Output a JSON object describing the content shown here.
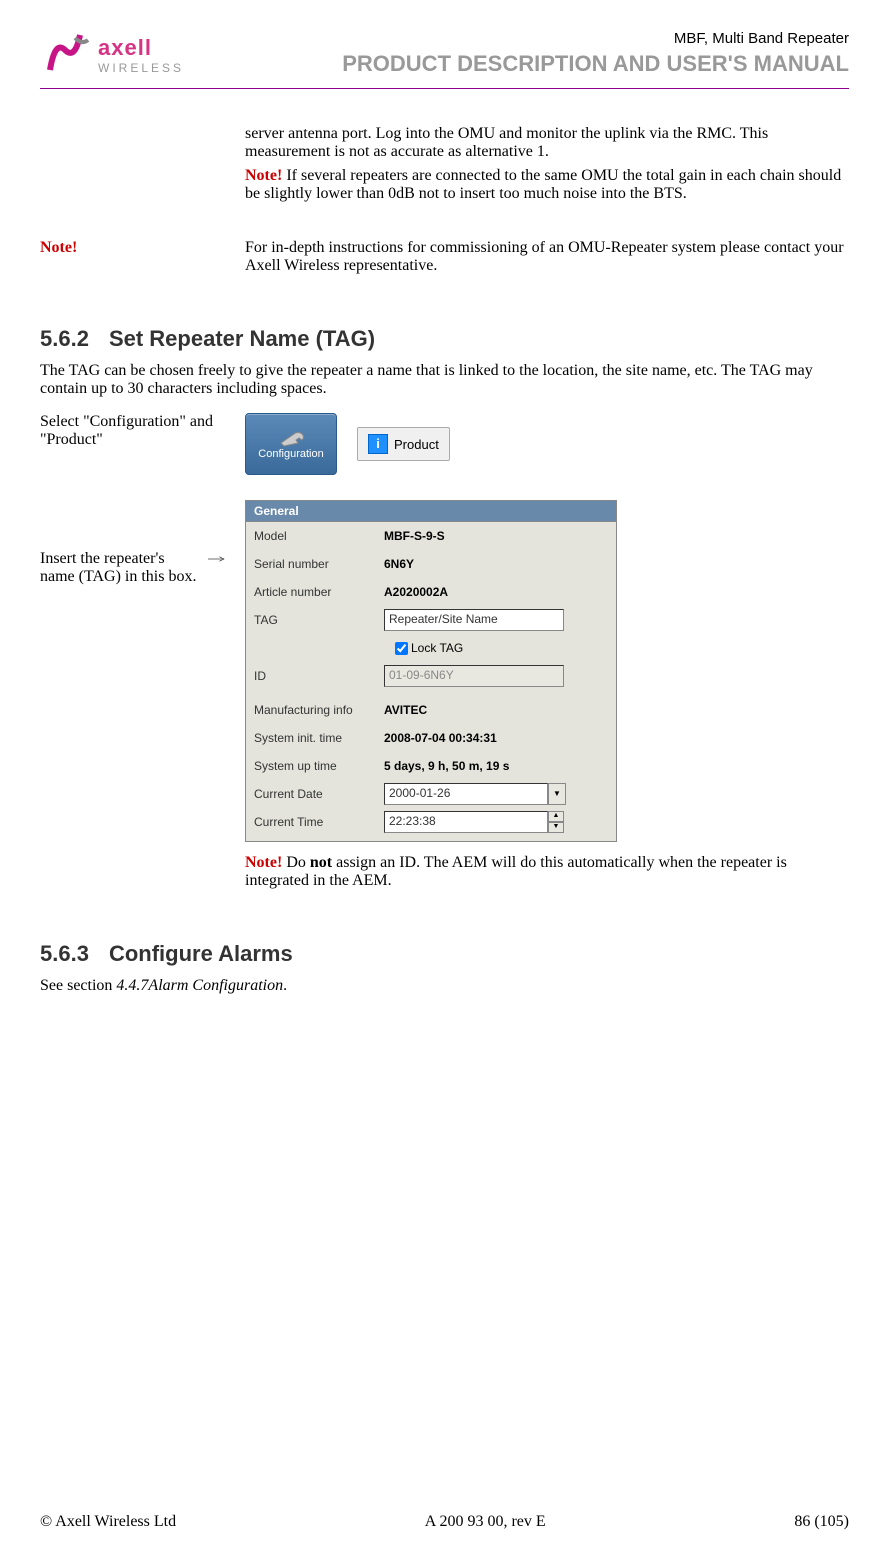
{
  "header": {
    "logo_main": "axell",
    "logo_sub": "WIRELESS",
    "doc_small": "MBF, Multi Band Repeater",
    "doc_big": "PRODUCT DESCRIPTION AND USER'S MANUAL"
  },
  "para1": "server antenna port. Log into the OMU and monitor the uplink via the RMC. This measurement is not as accurate as alternative 1.",
  "note1_prefix": "Note!",
  "note1_text": " If several repeaters are connected to the same OMU the total gain in each chain should be slightly lower than 0dB not to insert too much noise into the BTS.",
  "note_margin": "Note!",
  "note2_text": "For in-depth instructions for commissioning of an OMU-Repeater system please contact your Axell Wireless representative.",
  "sec562_num": "5.6.2",
  "sec562_title": "Set Repeater Name (TAG)",
  "sec562_body": "The TAG can be chosen freely to give the repeater a name that is linked to the location, the site name, etc. The TAG may contain up to 30 characters including spaces.",
  "instr1": "Select \"Configuration\" and \"Product\"",
  "instr2": "Insert the repeater's name (TAG) in this box.",
  "config_button": "Configuration",
  "product_button": "Product",
  "panel": {
    "title": "General",
    "rows": {
      "model_label": "Model",
      "model_value": "MBF-S-9-S",
      "serial_label": "Serial number",
      "serial_value": "6N6Y",
      "article_label": "Article number",
      "article_value": "A2020002A",
      "tag_label": "TAG",
      "tag_value": "Repeater/Site Name",
      "lock_tag": "Lock TAG",
      "id_label": "ID",
      "id_value": "01-09-6N6Y",
      "mfg_label": "Manufacturing info",
      "mfg_value": "AVITEC",
      "sysinit_label": "System init. time",
      "sysinit_value": "2008-07-04    00:34:31",
      "sysup_label": "System up time",
      "sysup_value": "5 days, 9 h, 50 m, 19 s",
      "curdate_label": "Current Date",
      "curdate_value": "2000-01-26",
      "curtime_label": "Current Time",
      "curtime_value": "22:23:38"
    }
  },
  "note3_prefix": "Note!",
  "note3_text1": " Do ",
  "note3_bold": "not",
  "note3_text2": " assign an ID. The AEM will do this automatically when the repeater is integrated in the AEM.",
  "sec563_num": "5.6.3",
  "sec563_title": "Configure Alarms",
  "sec563_body_pre": "See section ",
  "sec563_body_italic": "4.4.7Alarm Configuration",
  "sec563_body_post": ".",
  "footer": {
    "left": "© Axell Wireless Ltd",
    "center": "A 200 93 00, rev E",
    "right": "86 (105)"
  }
}
